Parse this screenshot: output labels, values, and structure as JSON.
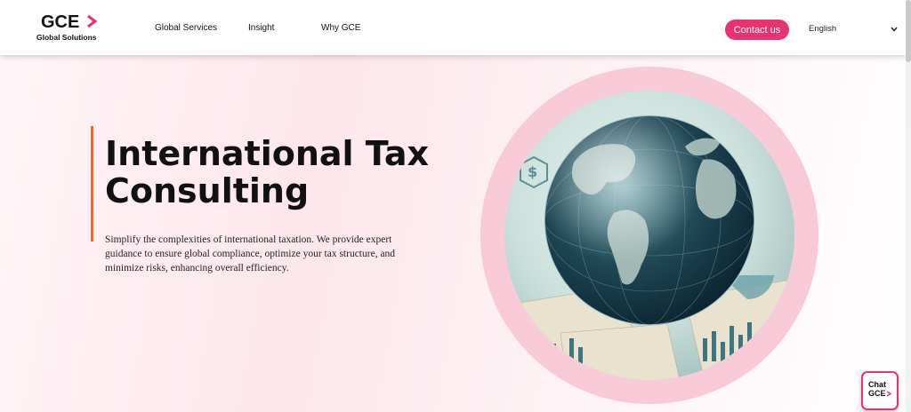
{
  "header": {
    "logo": {
      "mark": "GCE",
      "subtitle": "Global Solutions",
      "icon": "chevron-right-icon"
    },
    "nav": [
      {
        "label": "Global Services"
      },
      {
        "label": "Insight"
      },
      {
        "label": "Why GCE"
      }
    ],
    "contact_label": "Contact us",
    "language": {
      "selected": "English",
      "icon": "chevron-down-icon"
    }
  },
  "hero": {
    "title": "International Tax Consulting",
    "description": "Simplify the complexities of international taxation. We provide expert guidance to ensure global compliance, optimize your tax structure, and minimize risks, enhancing overall efficiency.",
    "image": "globe-with-financial-charts"
  },
  "chat": {
    "line1": "Chat",
    "line2": "GCE",
    "icon": "arrow-icon"
  },
  "colors": {
    "accent_pink": "#e8336e",
    "accent_orange": "#f2652b",
    "text_dark": "#111111",
    "background_pink": "#fde6ec"
  }
}
